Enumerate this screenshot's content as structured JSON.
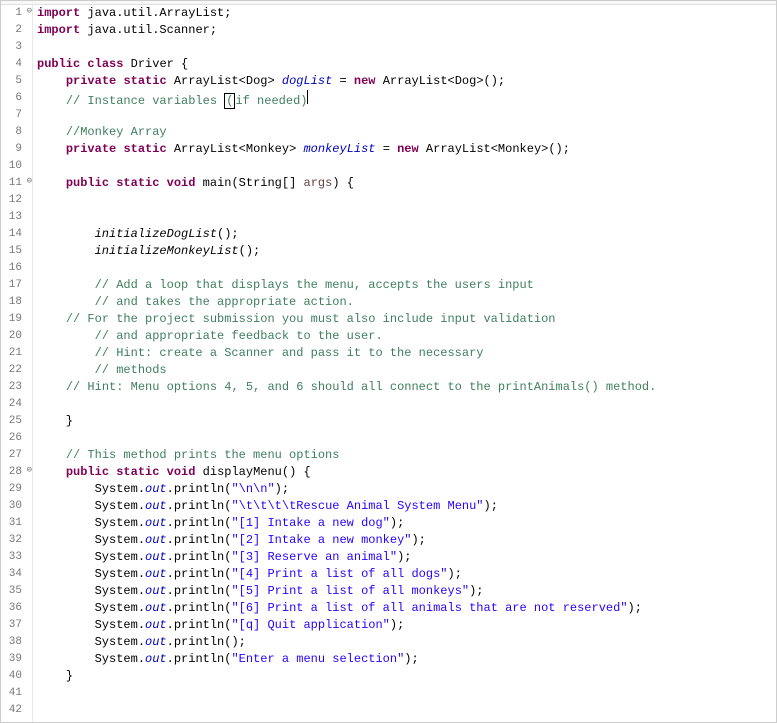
{
  "lines": [
    {
      "num": "1",
      "fold": "⊖",
      "tokens": [
        {
          "c": "kw",
          "t": "import"
        },
        {
          "c": "normal",
          "t": " java.util.ArrayList;"
        }
      ]
    },
    {
      "num": "2",
      "fold": "",
      "tokens": [
        {
          "c": "kw",
          "t": "import"
        },
        {
          "c": "normal",
          "t": " java.util.Scanner;"
        }
      ]
    },
    {
      "num": "3",
      "fold": "",
      "tokens": []
    },
    {
      "num": "4",
      "fold": "",
      "tokens": [
        {
          "c": "kw",
          "t": "public"
        },
        {
          "c": "normal",
          "t": " "
        },
        {
          "c": "kw",
          "t": "class"
        },
        {
          "c": "normal",
          "t": " Driver {"
        }
      ]
    },
    {
      "num": "5",
      "fold": "",
      "tokens": [
        {
          "c": "normal",
          "t": "    "
        },
        {
          "c": "kw",
          "t": "private"
        },
        {
          "c": "normal",
          "t": " "
        },
        {
          "c": "kw",
          "t": "static"
        },
        {
          "c": "normal",
          "t": " ArrayList<Dog> "
        },
        {
          "c": "static-field",
          "t": "dogList"
        },
        {
          "c": "normal",
          "t": " = "
        },
        {
          "c": "kw",
          "t": "new"
        },
        {
          "c": "normal",
          "t": " ArrayList<Dog>();"
        }
      ]
    },
    {
      "num": "6",
      "fold": "",
      "tokens": [
        {
          "c": "normal",
          "t": "    "
        },
        {
          "c": "comment",
          "t": "// Instance variables "
        },
        {
          "c": "comment cursor-box",
          "t": "("
        },
        {
          "c": "comment",
          "t": "if needed)"
        }
      ],
      "cursor": true
    },
    {
      "num": "7",
      "fold": "",
      "tokens": []
    },
    {
      "num": "8",
      "fold": "",
      "tokens": [
        {
          "c": "normal",
          "t": "    "
        },
        {
          "c": "comment",
          "t": "//Monkey Array"
        }
      ]
    },
    {
      "num": "9",
      "fold": "",
      "tokens": [
        {
          "c": "normal",
          "t": "    "
        },
        {
          "c": "kw",
          "t": "private"
        },
        {
          "c": "normal",
          "t": " "
        },
        {
          "c": "kw",
          "t": "static"
        },
        {
          "c": "normal",
          "t": " ArrayList<Monkey> "
        },
        {
          "c": "static-field",
          "t": "monkeyList"
        },
        {
          "c": "normal",
          "t": " = "
        },
        {
          "c": "kw",
          "t": "new"
        },
        {
          "c": "normal",
          "t": " ArrayList<Monkey>();"
        }
      ]
    },
    {
      "num": "10",
      "fold": "",
      "tokens": []
    },
    {
      "num": "11",
      "fold": "⊖",
      "tokens": [
        {
          "c": "normal",
          "t": "    "
        },
        {
          "c": "kw",
          "t": "public"
        },
        {
          "c": "normal",
          "t": " "
        },
        {
          "c": "kw",
          "t": "static"
        },
        {
          "c": "normal",
          "t": " "
        },
        {
          "c": "kw",
          "t": "void"
        },
        {
          "c": "normal",
          "t": " main(String[] "
        },
        {
          "c": "param",
          "t": "args"
        },
        {
          "c": "normal",
          "t": ") {"
        }
      ]
    },
    {
      "num": "12",
      "fold": "",
      "tokens": []
    },
    {
      "num": "13",
      "fold": "",
      "tokens": []
    },
    {
      "num": "14",
      "fold": "",
      "tokens": [
        {
          "c": "normal",
          "t": "        "
        },
        {
          "c": "static-method",
          "t": "initializeDogList"
        },
        {
          "c": "normal",
          "t": "();"
        }
      ]
    },
    {
      "num": "15",
      "fold": "",
      "tokens": [
        {
          "c": "normal",
          "t": "        "
        },
        {
          "c": "static-method",
          "t": "initializeMonkeyList"
        },
        {
          "c": "normal",
          "t": "();"
        }
      ]
    },
    {
      "num": "16",
      "fold": "",
      "tokens": []
    },
    {
      "num": "17",
      "fold": "",
      "tokens": [
        {
          "c": "normal",
          "t": "        "
        },
        {
          "c": "comment",
          "t": "// Add a loop that displays the menu, accepts the users input"
        }
      ]
    },
    {
      "num": "18",
      "fold": "",
      "tokens": [
        {
          "c": "normal",
          "t": "        "
        },
        {
          "c": "comment",
          "t": "// and takes the appropriate action."
        }
      ]
    },
    {
      "num": "19",
      "fold": "",
      "tokens": [
        {
          "c": "normal",
          "t": "    "
        },
        {
          "c": "comment",
          "t": "// For the project submission you must also include input validation"
        }
      ]
    },
    {
      "num": "20",
      "fold": "",
      "tokens": [
        {
          "c": "normal",
          "t": "        "
        },
        {
          "c": "comment",
          "t": "// and appropriate feedback to the user."
        }
      ]
    },
    {
      "num": "21",
      "fold": "",
      "tokens": [
        {
          "c": "normal",
          "t": "        "
        },
        {
          "c": "comment",
          "t": "// Hint: create a Scanner and pass it to the necessary"
        }
      ]
    },
    {
      "num": "22",
      "fold": "",
      "tokens": [
        {
          "c": "normal",
          "t": "        "
        },
        {
          "c": "comment",
          "t": "// methods"
        }
      ]
    },
    {
      "num": "23",
      "fold": "",
      "tokens": [
        {
          "c": "normal",
          "t": "    "
        },
        {
          "c": "comment",
          "t": "// Hint: Menu options 4, 5, and 6 should all connect to the printAnimals() method."
        }
      ]
    },
    {
      "num": "24",
      "fold": "",
      "tokens": []
    },
    {
      "num": "25",
      "fold": "",
      "tokens": [
        {
          "c": "normal",
          "t": "    }"
        }
      ]
    },
    {
      "num": "26",
      "fold": "",
      "tokens": []
    },
    {
      "num": "27",
      "fold": "",
      "tokens": [
        {
          "c": "normal",
          "t": "    "
        },
        {
          "c": "comment",
          "t": "// This method prints the menu options"
        }
      ]
    },
    {
      "num": "28",
      "fold": "⊖",
      "tokens": [
        {
          "c": "normal",
          "t": "    "
        },
        {
          "c": "kw",
          "t": "public"
        },
        {
          "c": "normal",
          "t": " "
        },
        {
          "c": "kw",
          "t": "static"
        },
        {
          "c": "normal",
          "t": " "
        },
        {
          "c": "kw",
          "t": "void"
        },
        {
          "c": "normal",
          "t": " displayMenu() {"
        }
      ]
    },
    {
      "num": "29",
      "fold": "",
      "tokens": [
        {
          "c": "normal",
          "t": "        System."
        },
        {
          "c": "static-field",
          "t": "out"
        },
        {
          "c": "normal",
          "t": ".println("
        },
        {
          "c": "string",
          "t": "\"\\n\\n\""
        },
        {
          "c": "normal",
          "t": ");"
        }
      ]
    },
    {
      "num": "30",
      "fold": "",
      "tokens": [
        {
          "c": "normal",
          "t": "        System."
        },
        {
          "c": "static-field",
          "t": "out"
        },
        {
          "c": "normal",
          "t": ".println("
        },
        {
          "c": "string",
          "t": "\"\\t\\t\\t\\tRescue Animal System Menu\""
        },
        {
          "c": "normal",
          "t": ");"
        }
      ]
    },
    {
      "num": "31",
      "fold": "",
      "tokens": [
        {
          "c": "normal",
          "t": "        System."
        },
        {
          "c": "static-field",
          "t": "out"
        },
        {
          "c": "normal",
          "t": ".println("
        },
        {
          "c": "string",
          "t": "\"[1] Intake a new dog\""
        },
        {
          "c": "normal",
          "t": ");"
        }
      ]
    },
    {
      "num": "32",
      "fold": "",
      "tokens": [
        {
          "c": "normal",
          "t": "        System."
        },
        {
          "c": "static-field",
          "t": "out"
        },
        {
          "c": "normal",
          "t": ".println("
        },
        {
          "c": "string",
          "t": "\"[2] Intake a new monkey\""
        },
        {
          "c": "normal",
          "t": ");"
        }
      ]
    },
    {
      "num": "33",
      "fold": "",
      "tokens": [
        {
          "c": "normal",
          "t": "        System."
        },
        {
          "c": "static-field",
          "t": "out"
        },
        {
          "c": "normal",
          "t": ".println("
        },
        {
          "c": "string",
          "t": "\"[3] Reserve an animal\""
        },
        {
          "c": "normal",
          "t": ");"
        }
      ]
    },
    {
      "num": "34",
      "fold": "",
      "tokens": [
        {
          "c": "normal",
          "t": "        System."
        },
        {
          "c": "static-field",
          "t": "out"
        },
        {
          "c": "normal",
          "t": ".println("
        },
        {
          "c": "string",
          "t": "\"[4] Print a list of all dogs\""
        },
        {
          "c": "normal",
          "t": ");"
        }
      ]
    },
    {
      "num": "35",
      "fold": "",
      "tokens": [
        {
          "c": "normal",
          "t": "        System."
        },
        {
          "c": "static-field",
          "t": "out"
        },
        {
          "c": "normal",
          "t": ".println("
        },
        {
          "c": "string",
          "t": "\"[5] Print a list of all monkeys\""
        },
        {
          "c": "normal",
          "t": ");"
        }
      ]
    },
    {
      "num": "36",
      "fold": "",
      "tokens": [
        {
          "c": "normal",
          "t": "        System."
        },
        {
          "c": "static-field",
          "t": "out"
        },
        {
          "c": "normal",
          "t": ".println("
        },
        {
          "c": "string",
          "t": "\"[6] Print a list of all animals that are not reserved\""
        },
        {
          "c": "normal",
          "t": ");"
        }
      ]
    },
    {
      "num": "37",
      "fold": "",
      "tokens": [
        {
          "c": "normal",
          "t": "        System."
        },
        {
          "c": "static-field",
          "t": "out"
        },
        {
          "c": "normal",
          "t": ".println("
        },
        {
          "c": "string",
          "t": "\"[q] Quit application\""
        },
        {
          "c": "normal",
          "t": ");"
        }
      ]
    },
    {
      "num": "38",
      "fold": "",
      "tokens": [
        {
          "c": "normal",
          "t": "        System."
        },
        {
          "c": "static-field",
          "t": "out"
        },
        {
          "c": "normal",
          "t": ".println();"
        }
      ]
    },
    {
      "num": "39",
      "fold": "",
      "tokens": [
        {
          "c": "normal",
          "t": "        System."
        },
        {
          "c": "static-field",
          "t": "out"
        },
        {
          "c": "normal",
          "t": ".println("
        },
        {
          "c": "string",
          "t": "\"Enter a menu selection\""
        },
        {
          "c": "normal",
          "t": ");"
        }
      ]
    },
    {
      "num": "40",
      "fold": "",
      "tokens": [
        {
          "c": "normal",
          "t": "    }"
        }
      ]
    },
    {
      "num": "41",
      "fold": "",
      "tokens": []
    },
    {
      "num": "42",
      "fold": "",
      "tokens": []
    }
  ]
}
